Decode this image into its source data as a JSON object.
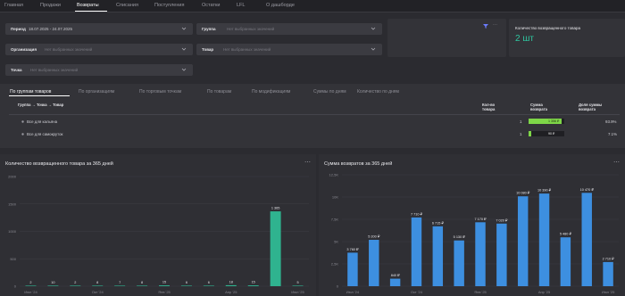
{
  "nav": {
    "tabs": [
      {
        "label": "Главная"
      },
      {
        "label": "Продажи"
      },
      {
        "label": "Возвраты",
        "active": true
      },
      {
        "label": "Списания"
      },
      {
        "label": "Поступления"
      },
      {
        "label": "Остатки"
      },
      {
        "label": "LFL"
      },
      {
        "label": "О дашборде"
      }
    ]
  },
  "filters": {
    "period": {
      "label": "Период",
      "value": "18.07.2025 - 24.07.2025"
    },
    "group": {
      "label": "Группа",
      "placeholder": "Нет выбранных значений"
    },
    "organization": {
      "label": "Организация",
      "placeholder": "Нет выбранных значений"
    },
    "product": {
      "label": "Товар",
      "placeholder": "Нет выбранных значений"
    },
    "point": {
      "label": "Точка",
      "placeholder": "Нет выбранных значений"
    }
  },
  "metric": {
    "title": "Количество возвращенного товара",
    "value": "2 шт",
    "color": "#2fc7a0"
  },
  "groups": {
    "tabs": [
      {
        "label": "По группам товаров",
        "active": true
      },
      {
        "label": "По организациям"
      },
      {
        "label": "По торговым точкам"
      },
      {
        "label": "По товарам"
      },
      {
        "label": "По модификациям"
      },
      {
        "label": "Суммы по дням"
      },
      {
        "label": "Количество по дням"
      }
    ],
    "columns": {
      "hierarchy": "Группа → Точка → Товар",
      "qty": "Кол-во товара",
      "sum": "Сумма возврата",
      "share": "Доля суммы возврата"
    },
    "rows": [
      {
        "name": "Все для кальяна",
        "qty": "1",
        "sum": "1 356 ₽",
        "sum_fraction": 0.93,
        "share": "93.9%"
      },
      {
        "name": "Все для самокруток",
        "qty": "1",
        "sum": "90 ₽",
        "sum_fraction": 0.07,
        "share": "7.1%"
      }
    ]
  },
  "menu_icon": "more-dots-icon",
  "chart_data": [
    {
      "type": "bar",
      "title": "Количество возвращенного товара за 365 дней",
      "color": "#2fb38f",
      "ylim": [
        0,
        2000
      ],
      "yticks": [
        "0",
        "500",
        "1000",
        "1500",
        "2000"
      ],
      "x_tick_labels": [
        "Июл '24",
        "Окт '24",
        "Янв '25",
        "Апр '25",
        "Июл '25"
      ],
      "values": [
        2,
        10,
        2,
        8,
        7,
        8,
        15,
        6,
        6,
        18,
        15,
        1365,
        5
      ],
      "labels": [
        "2",
        "10",
        "2",
        "8",
        "7",
        "8",
        "15",
        "6",
        "6",
        "18",
        "15",
        "1 365",
        "5"
      ]
    },
    {
      "type": "bar",
      "title": "Сумма возвратов за 365 дней",
      "color": "#3d8fe0",
      "ylim": [
        0,
        12500
      ],
      "yticks": [
        "0",
        "2,5K",
        "5K",
        "7,5K",
        "10K",
        "12,5K"
      ],
      "x_tick_labels": [
        "Июл '24",
        "Окт '24",
        "Янв '25",
        "Апр '25",
        "Июл '25"
      ],
      "values": [
        3760,
        5200,
        840,
        7710,
        6715,
        5130,
        7170,
        7020,
        10080,
        10390,
        5480,
        10470,
        2710
      ],
      "labels": [
        "3 760 ₽",
        "5 200 ₽",
        "840 ₽",
        "7 710 ₽",
        "6 715 ₽",
        "5 130 ₽",
        "7 170 ₽",
        "7 020 ₽",
        "10 080 ₽",
        "10 390 ₽",
        "5 480 ₽",
        "10 470 ₽",
        "2 710 ₽"
      ]
    }
  ]
}
